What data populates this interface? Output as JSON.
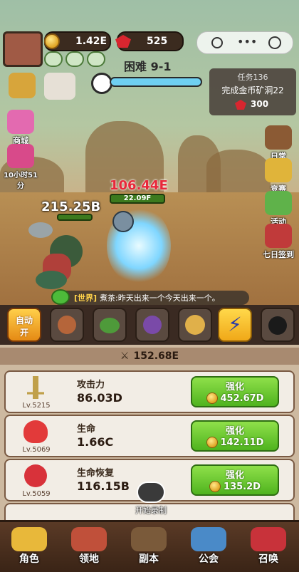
{
  "header": {
    "coins": "1.42E",
    "gems": "525",
    "stage": "困难 9-1"
  },
  "task": {
    "title": "任务136",
    "desc": "完成金币矿洞22",
    "reward": "300"
  },
  "left_menu": [
    {
      "label": "商城",
      "icon": "shop-icon"
    },
    {
      "label": "10小时51分",
      "icon": "calendar-clock-icon"
    }
  ],
  "right_menu": [
    {
      "label": "日常",
      "icon": "wallet-icon"
    },
    {
      "label": "竞赛",
      "icon": "trophy-icon"
    },
    {
      "label": "活动",
      "icon": "pinwheel-icon"
    },
    {
      "label": "七日签到",
      "icon": "sign-in-icon"
    }
  ],
  "battle": {
    "damage": "106.44E",
    "enemy_hp": "22.09F",
    "team_hp": "215.25B"
  },
  "chat": {
    "channel": "[世界]",
    "message": "煮茶:昨天出来一个今天出来一个。"
  },
  "skills": {
    "auto_label_1": "自动",
    "auto_label_2": "开"
  },
  "power": "152.68E",
  "upgrades": [
    {
      "name": "攻击力",
      "value": "86.03D",
      "level": "Lv.5215",
      "button": "强化",
      "cost": "452.67D"
    },
    {
      "name": "生命",
      "value": "1.66C",
      "level": "Lv.5069",
      "button": "强化",
      "cost": "142.11D"
    },
    {
      "name": "生命恢复",
      "value": "116.15B",
      "level": "Lv.5059",
      "button": "强化",
      "cost": "135.2D"
    }
  ],
  "record_label": "开始录制",
  "bottom_nav": [
    {
      "label": "角色"
    },
    {
      "label": "领地"
    },
    {
      "label": "副本"
    },
    {
      "label": "公会"
    },
    {
      "label": "召唤"
    }
  ],
  "colors": {
    "accent": "#5ac21f",
    "gem": "#d8262f",
    "coin": "#e0a424"
  }
}
